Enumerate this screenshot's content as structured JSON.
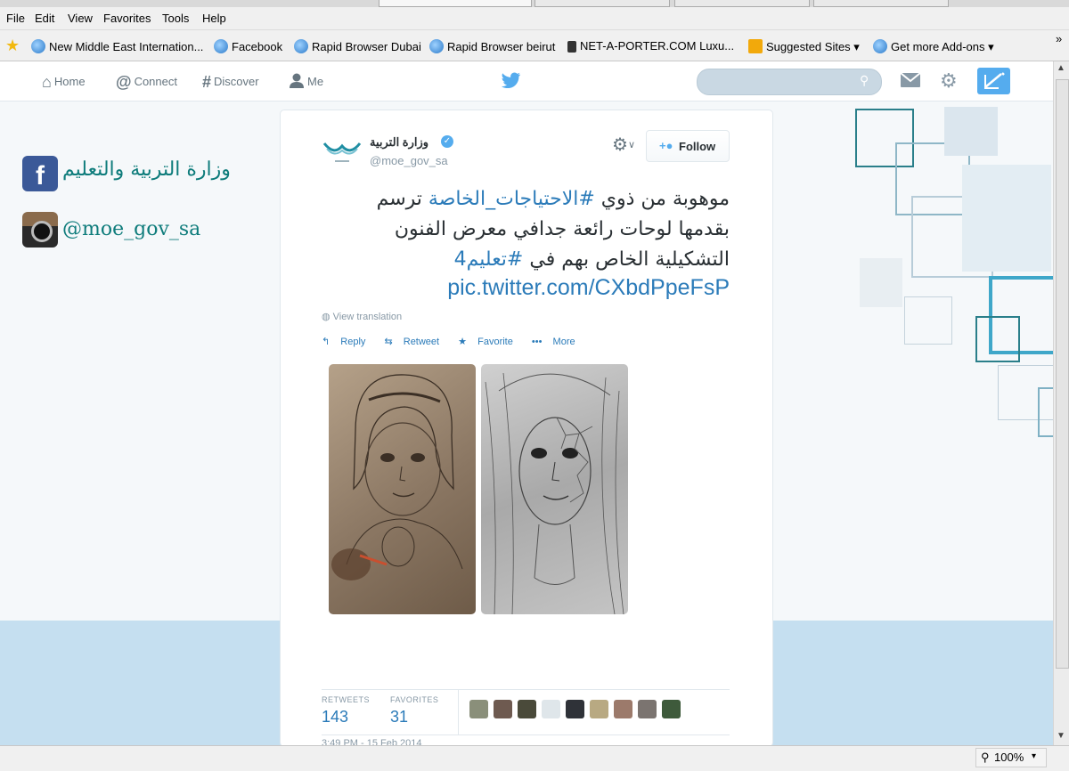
{
  "browser": {
    "menu": [
      "File",
      "Edit",
      "View",
      "Favorites",
      "Tools",
      "Help"
    ],
    "favorites": [
      {
        "label": "New Middle East Internation...",
        "icon": "ie-page-icon"
      },
      {
        "label": "Facebook",
        "icon": "ie-page-icon"
      },
      {
        "label": "Rapid Browser Dubai",
        "icon": "ie-page-icon"
      },
      {
        "label": "Rapid Browser beirut",
        "icon": "ie-page-icon"
      },
      {
        "label": "NET-A-PORTER.COM  Luxu...",
        "icon": "lock-icon"
      },
      {
        "label": "Suggested Sites ▾",
        "icon": "suggested-sites-icon"
      },
      {
        "label": "Get more Add-ons ▾",
        "icon": "ie-page-icon"
      }
    ],
    "overflow": "»",
    "zoom": "100%"
  },
  "twitter_nav": {
    "home": "Home",
    "connect": "Connect",
    "discover": "Discover",
    "me": "Me",
    "search_placeholder": ""
  },
  "profile_links": {
    "facebook_label": "وزارة التربية والتعليم",
    "instagram_label": "@moe_gov_sa"
  },
  "tweet": {
    "display_name": "وزارة التربية",
    "handle": "@moe_gov_sa",
    "follow_label": "Follow",
    "text_line1_pre": "موهوبة من ذوي ",
    "text_hashtag1": "#الاحتياجات_الخاصة",
    "text_line1_post": " ترسم",
    "text_line2": "بقدمها لوحات رائعة جدافي معرض الفنون",
    "text_line3_pre": "التشكيلية الخاص بهم في ",
    "text_hashtag2": "#تعليم4",
    "pic_link": "pic.twitter.com/CXbdPpeFsP",
    "view_translation": "View translation",
    "actions": {
      "reply": "Reply",
      "retweet": "Retweet",
      "favorite": "Favorite",
      "more": "More"
    },
    "retweets_label": "RETWEETS",
    "retweets_count": "143",
    "favorites_label": "FAVORITES",
    "favorites_count": "31",
    "timestamp": "3:49 PM - 15 Feb 2014"
  },
  "colors": {
    "twitter_blue": "#55acee",
    "link_blue": "#2b7bb9",
    "teal_label": "#0e7c7b",
    "facebook_blue": "#3b5998"
  }
}
